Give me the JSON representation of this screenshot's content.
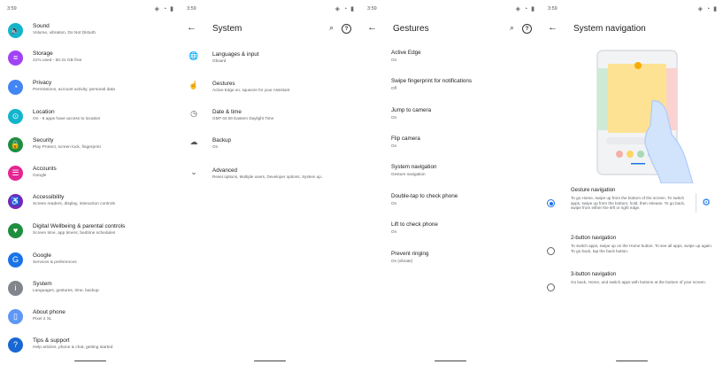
{
  "colors": {
    "accent": "#1a73e8"
  },
  "panels": {
    "settings": {
      "time": "3:59",
      "items": [
        {
          "title": "Sound",
          "sub": "Volume, vibration, Do Not Disturb",
          "color": "#12b5cb",
          "icon": "speaker-icon",
          "glyph": "🔈"
        },
        {
          "title": "Storage",
          "sub": "21% used - 50.31 GB free",
          "color": "#a142f4",
          "icon": "storage-icon",
          "glyph": "≡"
        },
        {
          "title": "Privacy",
          "sub": "Permissions, account activity, personal data",
          "color": "#4285f4",
          "icon": "privacy-icon",
          "glyph": "◔"
        },
        {
          "title": "Location",
          "sub": "On - 6 apps have access to location",
          "color": "#12b5cb",
          "icon": "location-icon",
          "glyph": "⊙"
        },
        {
          "title": "Security",
          "sub": "Play Protect, screen lock, fingerprint",
          "color": "#1e8e3e",
          "icon": "lock-icon",
          "glyph": "🔒"
        },
        {
          "title": "Accounts",
          "sub": "Google",
          "color": "#e52592",
          "icon": "accounts-icon",
          "glyph": "☰"
        },
        {
          "title": "Accessibility",
          "sub": "Screen readers, display, interaction controls",
          "color": "#7627bb",
          "icon": "accessibility-icon",
          "glyph": "♿"
        },
        {
          "title": "Digital Wellbeing & parental controls",
          "sub": "Screen time, app timers, bedtime schedules",
          "color": "#1e8e3e",
          "icon": "wellbeing-icon",
          "glyph": "♥"
        },
        {
          "title": "Google",
          "sub": "Services & preferences",
          "color": "#1a73e8",
          "icon": "google-icon",
          "glyph": "G"
        },
        {
          "title": "System",
          "sub": "Languages, gestures, time, backup",
          "color": "#80868b",
          "icon": "info-icon",
          "glyph": "i"
        },
        {
          "title": "About phone",
          "sub": "Pixel 2 XL",
          "color": "#5e97f6",
          "icon": "phone-icon",
          "glyph": "▯"
        },
        {
          "title": "Tips & support",
          "sub": "Help articles, phone & chat, getting started",
          "color": "#1967d2",
          "icon": "help-icon",
          "glyph": "?"
        }
      ]
    },
    "system": {
      "time": "3:59",
      "title": "System",
      "items": [
        {
          "title": "Languages & input",
          "sub": "Gboard",
          "icon": "globe-icon",
          "glyph": "🌐"
        },
        {
          "title": "Gestures",
          "sub": "Active Edge on, squeeze for your Assistant",
          "icon": "gesture-icon",
          "glyph": "☝"
        },
        {
          "title": "Date & time",
          "sub": "GMT-04:00 Eastern Daylight Time",
          "icon": "clock-icon",
          "glyph": "◷"
        },
        {
          "title": "Backup",
          "sub": "On",
          "icon": "cloud-upload-icon",
          "glyph": "☁"
        },
        {
          "title": "Advanced",
          "sub": "Reset options, Multiple users, Developer options, System up..",
          "icon": "chevron-down-icon",
          "glyph": "⌄"
        }
      ]
    },
    "gestures": {
      "time": "3:59",
      "title": "Gestures",
      "items": [
        {
          "title": "Active Edge",
          "sub": "On"
        },
        {
          "title": "Swipe fingerprint for notifications",
          "sub": "Off"
        },
        {
          "title": "Jump to camera",
          "sub": "On"
        },
        {
          "title": "Flip camera",
          "sub": "On"
        },
        {
          "title": "System navigation",
          "sub": "Gesture navigation"
        },
        {
          "title": "Double-tap to check phone",
          "sub": "On"
        },
        {
          "title": "Lift to check phone",
          "sub": "On"
        },
        {
          "title": "Prevent ringing",
          "sub": "On (vibrate)"
        }
      ]
    },
    "navigation": {
      "time": "3:59",
      "title": "System navigation",
      "options": [
        {
          "title": "Gesture navigation",
          "desc": "To go Home, swipe up from the bottom of the screen. To switch apps, swipe up from the bottom, hold, then release. To go back, swipe from either the left or right edge.",
          "selected": true
        },
        {
          "title": "2-button navigation",
          "desc": "To switch apps, swipe up on the Home button. To see all apps, swipe up again. To go back, tap the back button.",
          "selected": false
        },
        {
          "title": "3-button navigation",
          "desc": "Go back, Home, and switch apps with buttons at the bottom of your screen.",
          "selected": false
        }
      ]
    }
  }
}
